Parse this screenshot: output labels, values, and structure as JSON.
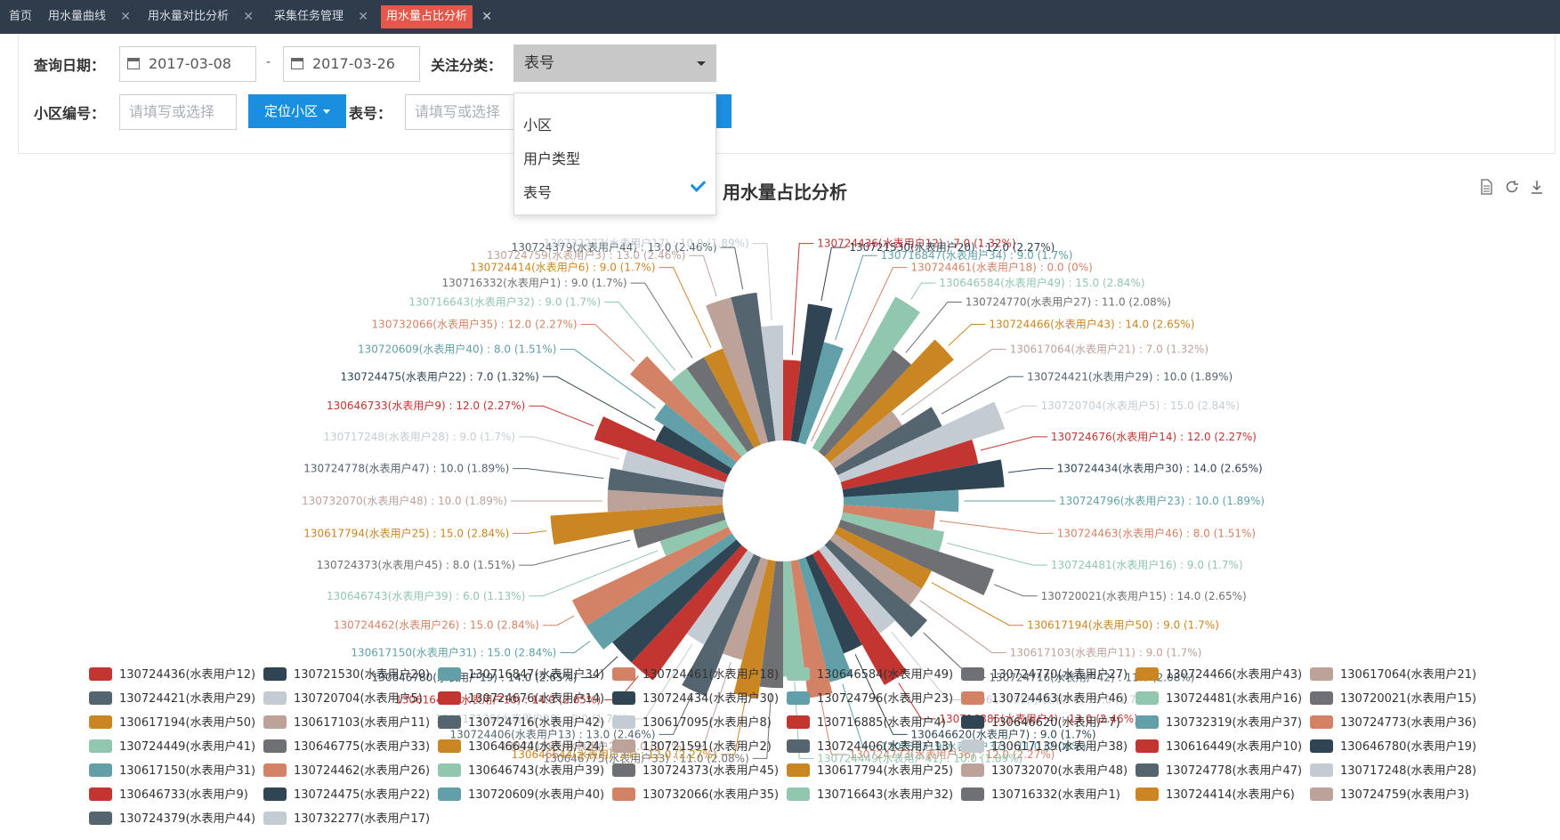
{
  "tabs": [
    {
      "label": "首页",
      "active": false,
      "closable": false
    },
    {
      "label": "用水量曲线",
      "active": false,
      "closable": true
    },
    {
      "label": "用水量对比分析",
      "active": false,
      "closable": true
    },
    {
      "label": "采集任务管理",
      "active": false,
      "closable": true
    },
    {
      "label": "用水量占比分析",
      "active": true,
      "closable": true
    }
  ],
  "filters": {
    "date_label": "查询日期：",
    "date_start": "2017-03-08",
    "date_sep": "-",
    "date_end": "2017-03-26",
    "category_label": "关注分类：",
    "category_value": "表号",
    "area_label": "小区编号：",
    "area_placeholder": "请填写或选择",
    "locate_button": "定位小区",
    "meter_label": "表号：",
    "meter_placeholder": "请填写或选择"
  },
  "dropdown": {
    "options": [
      "小区",
      "用户类型",
      "表号"
    ],
    "selected": "表号"
  },
  "icons": {
    "calendar": "calendar-icon",
    "data_view": "document-icon",
    "restore": "refresh-icon",
    "save": "download-icon"
  },
  "chart_data": {
    "type": "nightingale-rose",
    "title": "用水量占比分析",
    "unit_format": "{name} : {value} ({percent}%)",
    "series": [
      {
        "name": "130724436(水表用户12)",
        "value": 7.0,
        "percent": "1.32",
        "color": "#c23531"
      },
      {
        "name": "130721530(水表用户20)",
        "value": 12.0,
        "percent": "2.27",
        "color": "#2f4554"
      },
      {
        "name": "130716847(水表用户34)",
        "value": 9.0,
        "percent": "1.7",
        "color": "#61a0a8"
      },
      {
        "name": "130724461(水表用户18)",
        "value": 0.0,
        "percent": "0",
        "color": "#d48265"
      },
      {
        "name": "130646584(水表用户49)",
        "value": 15.0,
        "percent": "2.84",
        "color": "#91c7ae"
      },
      {
        "name": "130724770(水表用户27)",
        "value": 11.0,
        "percent": "2.08",
        "color": "#6e7074"
      },
      {
        "name": "130724466(水表用户43)",
        "value": 14.0,
        "percent": "2.65",
        "color": "#ca8622"
      },
      {
        "name": "130617064(水表用户21)",
        "value": 7.0,
        "percent": "1.32",
        "color": "#bda29a"
      },
      {
        "name": "130724421(水表用户29)",
        "value": 10.0,
        "percent": "1.89",
        "color": "#546570"
      },
      {
        "name": "130720704(水表用户5)",
        "value": 15.0,
        "percent": "2.84",
        "color": "#c4ccd3"
      },
      {
        "name": "130724676(水表用户14)",
        "value": 12.0,
        "percent": "2.27",
        "color": "#c23531"
      },
      {
        "name": "130724434(水表用户30)",
        "value": 14.0,
        "percent": "2.65",
        "color": "#2f4554"
      },
      {
        "name": "130724796(水表用户23)",
        "value": 10.0,
        "percent": "1.89",
        "color": "#61a0a8"
      },
      {
        "name": "130724463(水表用户46)",
        "value": 8.0,
        "percent": "1.51",
        "color": "#d48265"
      },
      {
        "name": "130724481(水表用户16)",
        "value": 9.0,
        "percent": "1.7",
        "color": "#91c7ae"
      },
      {
        "name": "130720021(水表用户15)",
        "value": 14.0,
        "percent": "2.65",
        "color": "#6e7074"
      },
      {
        "name": "130617194(水表用户50)",
        "value": 9.0,
        "percent": "1.7",
        "color": "#ca8622"
      },
      {
        "name": "130617103(水表用户11)",
        "value": 9.0,
        "percent": "1.7",
        "color": "#bda29a"
      },
      {
        "name": "130724716(水表用户42)",
        "value": 11.0,
        "percent": "2.08",
        "color": "#546570"
      },
      {
        "name": "130617095(水表用户8)",
        "value": 9.0,
        "percent": "1.7",
        "color": "#c4ccd3"
      },
      {
        "name": "130716885(水表用户4)",
        "value": 13.0,
        "percent": "2.46",
        "color": "#c23531"
      },
      {
        "name": "130646620(水表用户7)",
        "value": 9.0,
        "percent": "1.7",
        "color": "#2f4554"
      },
      {
        "name": "130732319(水表用户37)",
        "value": 11.0,
        "percent": "2.08",
        "color": "#61a0a8"
      },
      {
        "name": "130724773(水表用户36)",
        "value": 12.0,
        "percent": "2.27",
        "color": "#d48265"
      },
      {
        "name": "130724449(水表用户41)",
        "value": 10.0,
        "percent": "1.89",
        "color": "#91c7ae"
      },
      {
        "name": "130646775(水表用户33)",
        "value": 11.0,
        "percent": "2.08",
        "color": "#6e7074"
      },
      {
        "name": "130646644(水表用户24)",
        "value": 12.0,
        "percent": "2.27",
        "color": "#ca8622"
      },
      {
        "name": "130721591(水表用户2)",
        "value": 9.0,
        "percent": "1.7",
        "color": "#bda29a"
      },
      {
        "name": "130724406(水表用户13)",
        "value": 13.0,
        "percent": "2.46",
        "color": "#546570"
      },
      {
        "name": "130617139(水表用户38)",
        "value": 9.0,
        "percent": "1.7",
        "color": "#c4ccd3"
      },
      {
        "name": "130616449(水表用户10)",
        "value": 14.0,
        "percent": "2.65",
        "color": "#c23531"
      },
      {
        "name": "130646780(水表用户19)",
        "value": 14.0,
        "percent": "2.65",
        "color": "#2f4554"
      },
      {
        "name": "130617150(水表用户31)",
        "value": 15.0,
        "percent": "2.84",
        "color": "#61a0a8"
      },
      {
        "name": "130724462(水表用户26)",
        "value": 15.0,
        "percent": "2.84",
        "color": "#d48265"
      },
      {
        "name": "130646743(水表用户39)",
        "value": 6.0,
        "percent": "1.13",
        "color": "#91c7ae"
      },
      {
        "name": "130724373(水表用户45)",
        "value": 8.0,
        "percent": "1.51",
        "color": "#6e7074"
      },
      {
        "name": "130617794(水表用户25)",
        "value": 15.0,
        "percent": "2.84",
        "color": "#ca8622"
      },
      {
        "name": "130732070(水表用户48)",
        "value": 10.0,
        "percent": "1.89",
        "color": "#bda29a"
      },
      {
        "name": "130724778(水表用户47)",
        "value": 10.0,
        "percent": "1.89",
        "color": "#546570"
      },
      {
        "name": "130717248(水表用户28)",
        "value": 9.0,
        "percent": "1.7",
        "color": "#c4ccd3"
      },
      {
        "name": "130646733(水表用户9)",
        "value": 12.0,
        "percent": "2.27",
        "color": "#c23531"
      },
      {
        "name": "130724475(水表用户22)",
        "value": 7.0,
        "percent": "1.32",
        "color": "#2f4554"
      },
      {
        "name": "130720609(水表用户40)",
        "value": 8.0,
        "percent": "1.51",
        "color": "#61a0a8"
      },
      {
        "name": "130732066(水表用户35)",
        "value": 12.0,
        "percent": "2.27",
        "color": "#d48265"
      },
      {
        "name": "130716643(水表用户32)",
        "value": 9.0,
        "percent": "1.7",
        "color": "#91c7ae"
      },
      {
        "name": "130716332(水表用户1)",
        "value": 9.0,
        "percent": "1.7",
        "color": "#6e7074"
      },
      {
        "name": "130724414(水表用户6)",
        "value": 9.0,
        "percent": "1.7",
        "color": "#ca8622"
      },
      {
        "name": "130724759(水表用户3)",
        "value": 13.0,
        "percent": "2.46",
        "color": "#bda29a"
      },
      {
        "name": "130724379(水表用户44)",
        "value": 13.0,
        "percent": "2.46",
        "color": "#546570"
      },
      {
        "name": "130732277(水表用户17)",
        "value": 10.0,
        "percent": "1.89",
        "color": "#c4ccd3"
      }
    ]
  }
}
